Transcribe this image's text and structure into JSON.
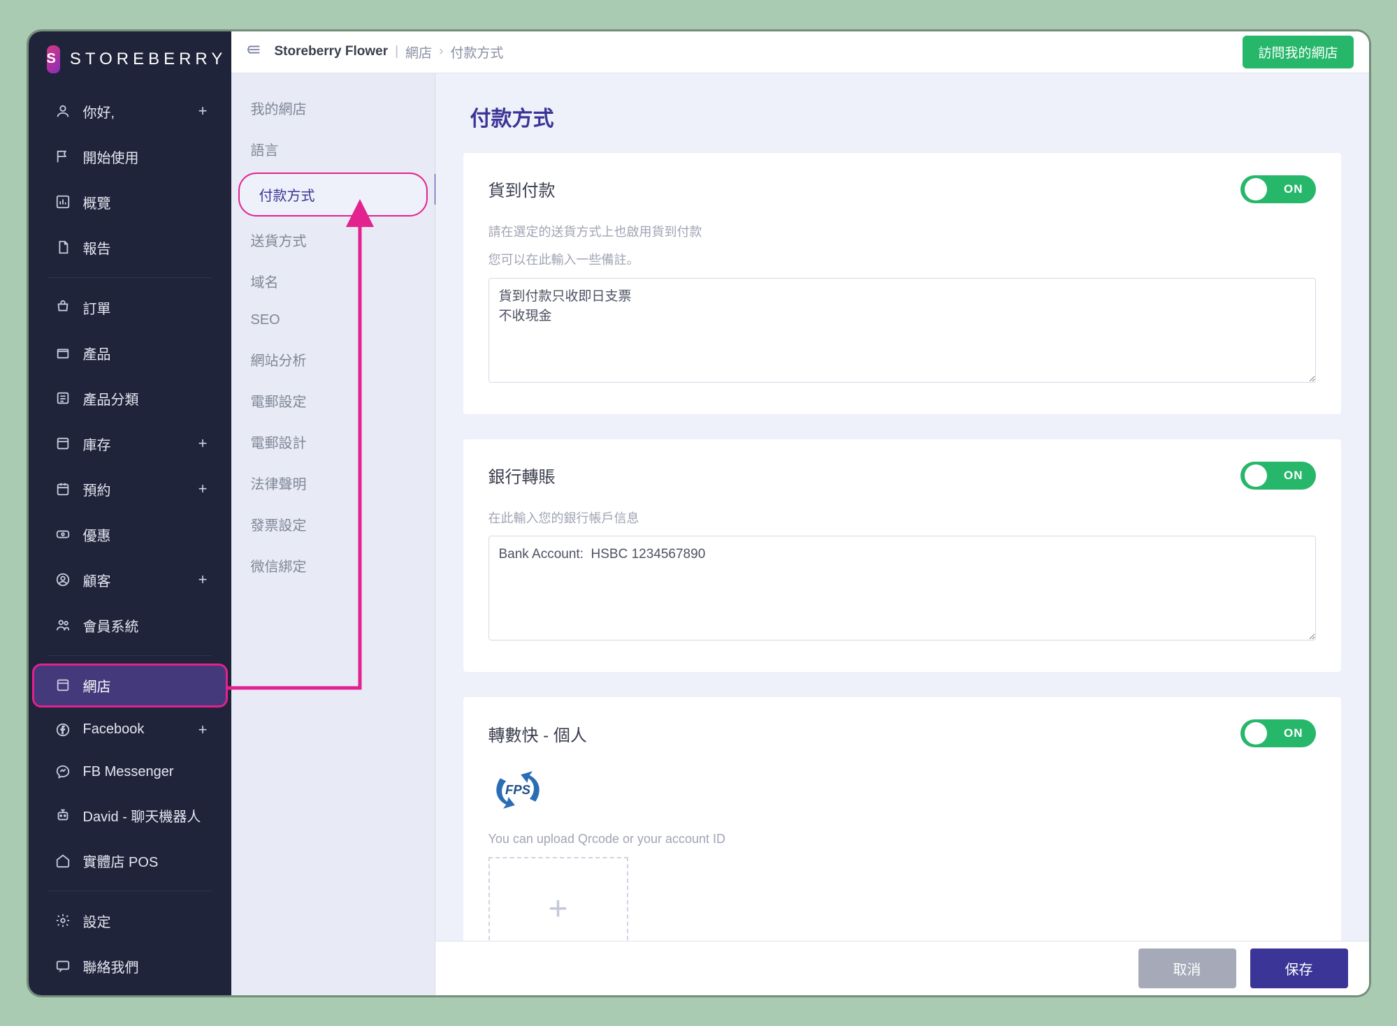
{
  "brand": {
    "logo_text": "STOREBERRY",
    "logo_badge": "S♭"
  },
  "topbar": {
    "store_name": "Storeberry Flower",
    "crumb1": "網店",
    "crumb2": "付款方式",
    "visit_label": "訪問我的網店"
  },
  "sidebar": {
    "greeting": "你好,",
    "items": [
      {
        "label": "開始使用"
      },
      {
        "label": "概覽"
      },
      {
        "label": "報告"
      }
    ],
    "items2": [
      {
        "label": "訂單"
      },
      {
        "label": "產品"
      },
      {
        "label": "產品分類"
      },
      {
        "label": "庫存",
        "plus": true
      },
      {
        "label": "預約",
        "plus": true
      },
      {
        "label": "優惠"
      },
      {
        "label": "顧客",
        "plus": true
      },
      {
        "label": "會員系統"
      }
    ],
    "items3": [
      {
        "label": "網店"
      },
      {
        "label": "Facebook",
        "plus": true
      },
      {
        "label": "FB Messenger"
      },
      {
        "label": "David - 聊天機器人"
      },
      {
        "label": "實體店 POS"
      }
    ],
    "items4": [
      {
        "label": "設定"
      },
      {
        "label": "聯絡我們"
      }
    ]
  },
  "subnav": {
    "items": [
      "我的網店",
      "語言",
      "付款方式",
      "送貨方式",
      "域名",
      "SEO",
      "網站分析",
      "電郵設定",
      "電郵設計",
      "法律聲明",
      "發票設定",
      "微信綁定"
    ],
    "selected_index": 2
  },
  "page": {
    "title": "付款方式",
    "toggle_on": "ON",
    "panel_cod": {
      "title": "貨到付款",
      "help1": "請在選定的送貨方式上也啟用貨到付款",
      "help2": "您可以在此輸入一些備註。",
      "note_value": "貨到付款只收即日支票\n不收現金"
    },
    "panel_bank": {
      "title": "銀行轉賬",
      "help": "在此輸入您的銀行帳戶信息",
      "note_value": "Bank Account:  HSBC 1234567890"
    },
    "panel_fps": {
      "title": "轉數快 - 個人",
      "logo_text": "FPS",
      "upload_help": "You can upload Qrcode or your account ID"
    }
  },
  "footer": {
    "cancel": "取消",
    "save": "保存"
  }
}
